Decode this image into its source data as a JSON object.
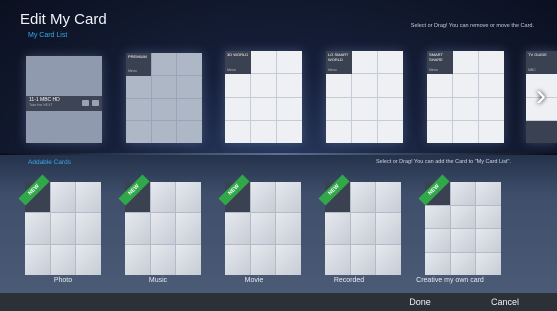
{
  "header": {
    "title": "Edit My Card",
    "subtitle": "My Card List",
    "hint": "Select or Drag! You can remove or move the Card."
  },
  "my_cards": [
    {
      "name": "tv-card",
      "channel": "11-1 MBC HD",
      "program": "Take the NEXT"
    },
    {
      "name": "premium-card",
      "label": "PREMIUM",
      "menu": "Menu"
    },
    {
      "name": "3d-world-card",
      "label": "3D WORLD",
      "menu": "Menu"
    },
    {
      "name": "lg-smart-world-card",
      "label": "LG SMART WORLD",
      "menu": "Menu"
    },
    {
      "name": "smart-share-card",
      "label": "SMART SHARE",
      "menu": "Menu"
    },
    {
      "name": "tv-guide-card",
      "label": "TV GUIDE",
      "menu": "MBC"
    }
  ],
  "addable": {
    "label": "Addable Cards",
    "hint": "Select or Drag! You can add the Card to \"My Card List\".",
    "new_badge": "NEW",
    "cards": [
      {
        "label": "Photo"
      },
      {
        "label": "Music"
      },
      {
        "label": "Movie"
      },
      {
        "label": "Recorded"
      },
      {
        "label": "Creative my own card"
      }
    ]
  },
  "footer": {
    "done": "Done",
    "cancel": "Cancel"
  },
  "colors": {
    "accent": "#3aa8e8",
    "new_badge": "#30a84a"
  }
}
